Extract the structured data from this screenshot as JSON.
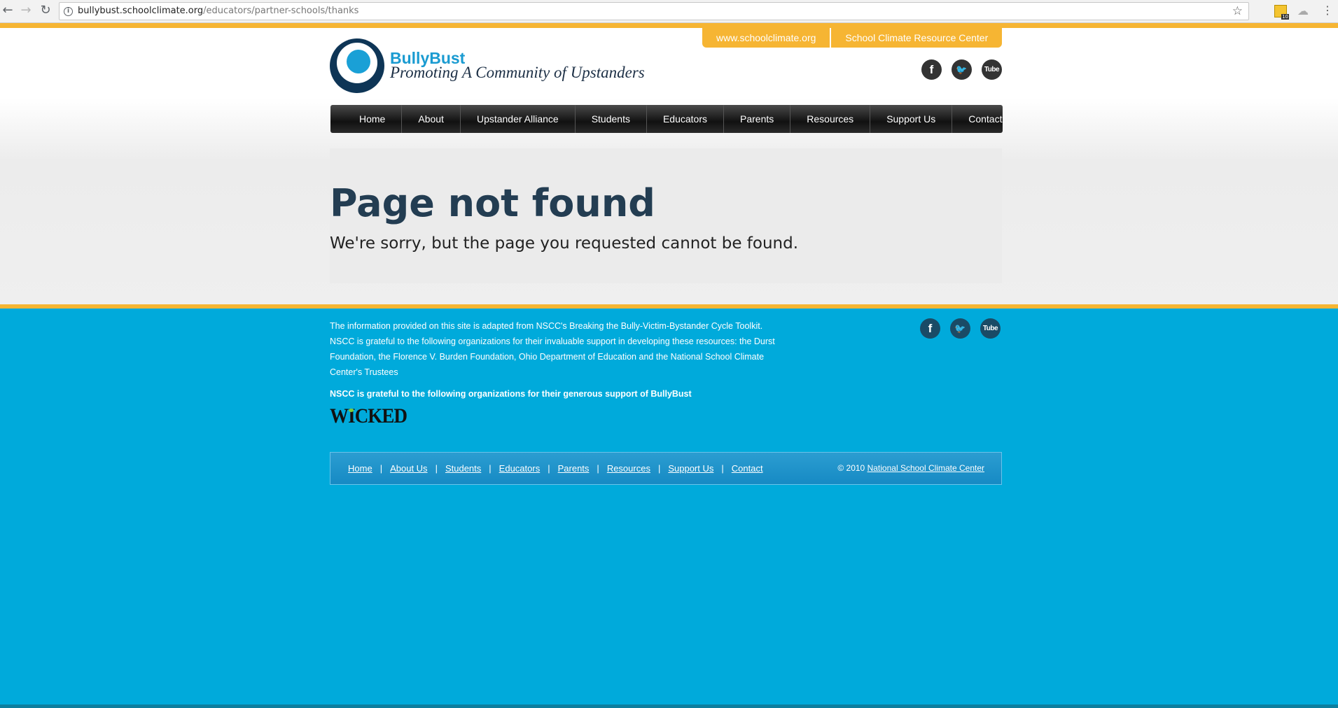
{
  "browser": {
    "url_host": "bullybust.schoolclimate.org",
    "url_path": "/educators/partner-schools/thanks",
    "extension_badge": "10"
  },
  "site": {
    "logo_name": "BullyBust",
    "logo_tagline": "Promoting A Community of Upstanders",
    "top_tabs": [
      "www.schoolclimate.org",
      "School Climate Resource Center"
    ],
    "social": {
      "facebook": "f",
      "twitter": "t",
      "youtube": "Tube"
    },
    "nav": [
      "Home",
      "About",
      "Upstander Alliance",
      "Students",
      "Educators",
      "Parents",
      "Resources",
      "Support Us",
      "Contact"
    ]
  },
  "content": {
    "title": "Page not found",
    "message": "We're sorry, but the page you requested cannot be found."
  },
  "footer": {
    "info_text": "The information provided on this site is adapted from NSCC's Breaking the Bully-Victim-Bystander Cycle Toolkit. NSCC is grateful to the following organizations for their invaluable support in developing these resources: the Durst Foundation, the Florence V. Burden Foundation, Ohio Department of Education and the National School Climate Center's Trustees",
    "thanks_text": "NSCC is grateful to the following organizations for their generous support of BullyBust",
    "sponsor_logo": "WICKED",
    "links": [
      "Home",
      "About Us",
      "Students",
      "Educators",
      "Parents",
      "Resources",
      "Support Us",
      "Contact"
    ],
    "copyright_prefix": "© 2010",
    "copyright_link": "National School Climate Center"
  },
  "colors": {
    "orange": "#f6b533",
    "page_blue": "#00aadb",
    "title_navy": "#233d52"
  }
}
